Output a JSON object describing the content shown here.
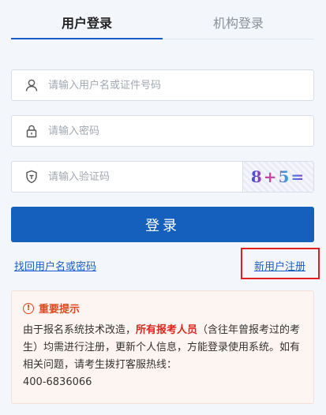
{
  "tabs": [
    {
      "label": "用户登录",
      "active": true
    },
    {
      "label": "机构登录",
      "active": false
    }
  ],
  "fields": {
    "username": {
      "placeholder": "请输入用户名或证件号码",
      "icon": "user-icon"
    },
    "password": {
      "placeholder": "请输入密码",
      "icon": "lock-icon"
    },
    "captcha": {
      "placeholder": "请输入验证码",
      "icon": "shield-icon",
      "image_text": "8+5="
    }
  },
  "login_button": "登录",
  "links": {
    "recover": "找回用户名或密码",
    "register": "新用户注册"
  },
  "notice": {
    "title": "重要提示",
    "icon": "exclamation-icon",
    "text_before": "由于报名系统技术改造，",
    "highlight": "所有报考人员",
    "text_after": "（含往年曾报考过的考生）均需进行注册，更新个人信息，方能登录使用系统。如有相关问题，请考生拨打客服热线：",
    "hotline": "400-6836066"
  },
  "colors": {
    "primary": "#1560bd",
    "warning": "#e0481e",
    "highlight_box": "#e02020",
    "background": "#f3f7fc"
  }
}
